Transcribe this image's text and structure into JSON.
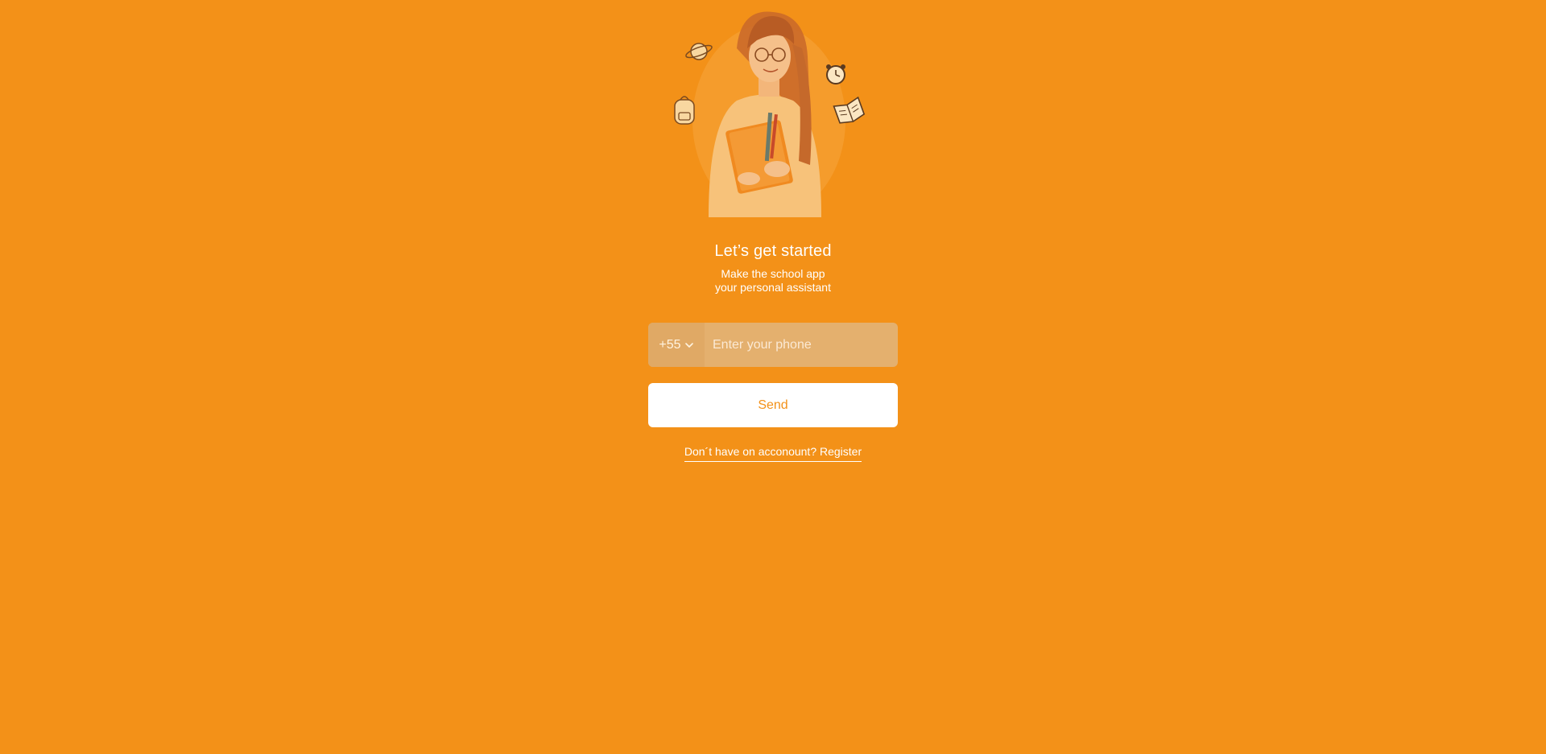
{
  "colors": {
    "background": "#f39118",
    "button_background": "#ffffff",
    "button_text": "#f39118",
    "input_background": "#e4b06e"
  },
  "hero": {
    "image": "student-girl-holding-books-illustration",
    "decorations": [
      "planet-icon",
      "alarm-clock-icon",
      "backpack-icon",
      "open-book-icon"
    ]
  },
  "heading": {
    "title": "Let’s get started",
    "subtitle_line1": "Make the school app",
    "subtitle_line2": "your personal assistant"
  },
  "phone_form": {
    "country_code": "+55",
    "country_code_icon": "chevron-down-icon",
    "phone_placeholder": "Enter your phone",
    "phone_value": "",
    "send_label": "Send"
  },
  "footer": {
    "register_link": "Don´t have on acconount? Register"
  }
}
